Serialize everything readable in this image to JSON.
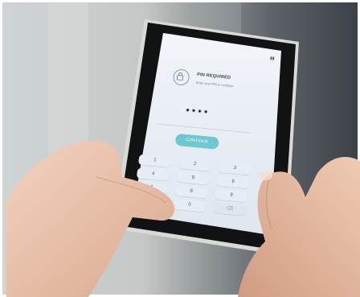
{
  "screen": {
    "title": "PIN REQUIRED",
    "subtitle": "Enter your PIN to continue",
    "pin_mask": "••••",
    "continue_label": "CONTINUE"
  },
  "keypad": {
    "keys": [
      "1",
      "2",
      "3",
      "4",
      "5",
      "6",
      "7",
      "8",
      "9",
      "0"
    ],
    "delete_icon": "backspace-icon"
  },
  "icons": {
    "lock": "lock-icon",
    "battery": "battery-icon"
  },
  "colors": {
    "accent": "#6fc7d1",
    "screen_bg": "#e9eef5"
  }
}
